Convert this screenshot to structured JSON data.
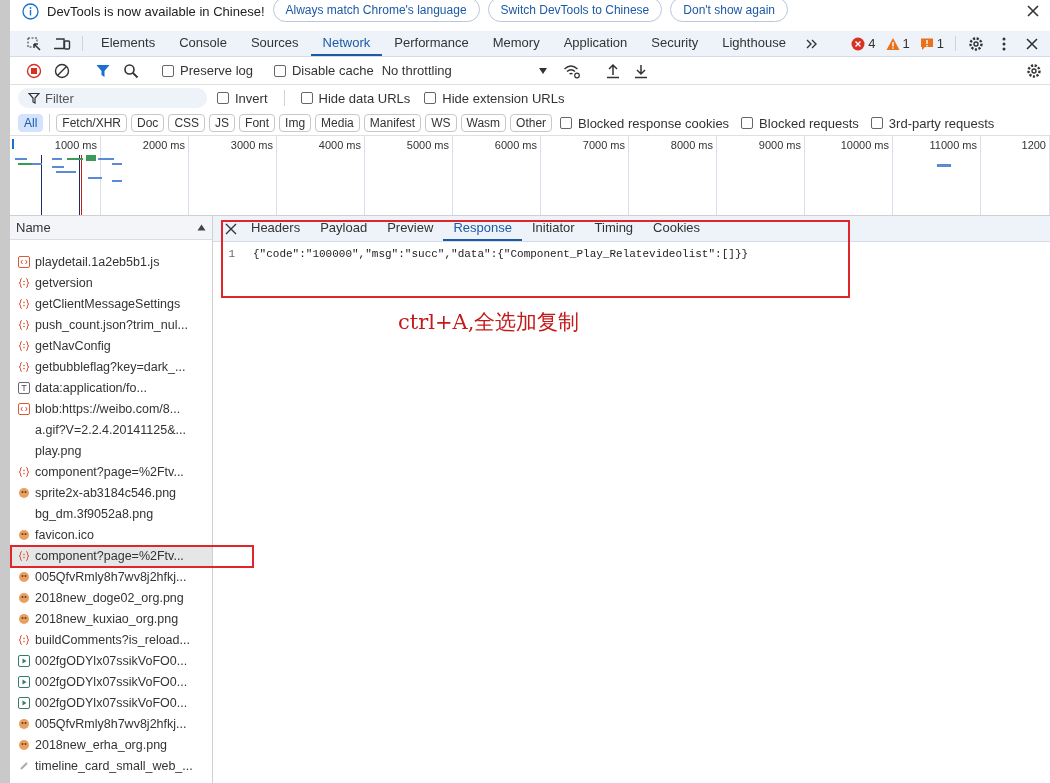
{
  "infobar": {
    "message": "DevTools is now available in Chinese!",
    "buttons": [
      "Always match Chrome's language",
      "Switch DevTools to Chinese",
      "Don't show again"
    ]
  },
  "panel_tabs": [
    {
      "label": "Elements",
      "selected": false
    },
    {
      "label": "Console",
      "selected": false
    },
    {
      "label": "Sources",
      "selected": false
    },
    {
      "label": "Network",
      "selected": true
    },
    {
      "label": "Performance",
      "selected": false
    },
    {
      "label": "Memory",
      "selected": false
    },
    {
      "label": "Application",
      "selected": false
    },
    {
      "label": "Security",
      "selected": false
    },
    {
      "label": "Lighthouse",
      "selected": false
    }
  ],
  "counters": {
    "errors": "4",
    "warnings": "1",
    "issues": "1"
  },
  "toolbar": {
    "preserve_log": {
      "label": "Preserve log",
      "checked": false
    },
    "disable_cache": {
      "label": "Disable cache",
      "checked": false
    },
    "throttling": "No throttling"
  },
  "filter_bar": {
    "placeholder": "Filter",
    "options": [
      {
        "label": "Invert",
        "checked": false
      },
      {
        "label": "Hide data URLs",
        "checked": false
      },
      {
        "label": "Hide extension URLs",
        "checked": false
      }
    ]
  },
  "type_filters": [
    {
      "label": "All",
      "selected": true
    },
    {
      "label": "Fetch/XHR",
      "selected": false
    },
    {
      "label": "Doc",
      "selected": false
    },
    {
      "label": "CSS",
      "selected": false
    },
    {
      "label": "JS",
      "selected": false
    },
    {
      "label": "Font",
      "selected": false
    },
    {
      "label": "Img",
      "selected": false
    },
    {
      "label": "Media",
      "selected": false
    },
    {
      "label": "Manifest",
      "selected": false
    },
    {
      "label": "WS",
      "selected": false
    },
    {
      "label": "Wasm",
      "selected": false
    },
    {
      "label": "Other",
      "selected": false
    }
  ],
  "more_filters": [
    {
      "label": "Blocked response cookies",
      "checked": false
    },
    {
      "label": "Blocked requests",
      "checked": false
    },
    {
      "label": "3rd-party requests",
      "checked": false
    }
  ],
  "timeline": {
    "ticks": [
      "1000 ms",
      "2000 ms",
      "3000 ms",
      "4000 ms",
      "5000 ms",
      "6000 ms",
      "7000 ms",
      "8000 ms",
      "9000 ms",
      "10000 ms",
      "11000 ms",
      "1200"
    ]
  },
  "requests": {
    "column": "Name",
    "rows": [
      {
        "name": "playdetail.1a2eb5b1.js",
        "kind": "script",
        "selected": false
      },
      {
        "name": "getversion",
        "kind": "fetch",
        "selected": false
      },
      {
        "name": "getClientMessageSettings",
        "kind": "fetch",
        "selected": false
      },
      {
        "name": "push_count.json?trim_nul...",
        "kind": "fetch",
        "selected": false
      },
      {
        "name": "getNavConfig",
        "kind": "fetch",
        "selected": false
      },
      {
        "name": "getbubbleflag?key=dark_...",
        "kind": "fetch",
        "selected": false
      },
      {
        "name": "data:application/fo...",
        "kind": "text",
        "selected": false
      },
      {
        "name": "blob:https://weibo.com/8...",
        "kind": "script",
        "selected": false
      },
      {
        "name": "a.gif?V=2.2.4.20141125&...",
        "kind": "blank",
        "selected": false
      },
      {
        "name": "play.png",
        "kind": "blank",
        "selected": false
      },
      {
        "name": "component?page=%2Ftv...",
        "kind": "fetch",
        "selected": false
      },
      {
        "name": "sprite2x-ab3184c546.png",
        "kind": "image",
        "selected": false
      },
      {
        "name": "bg_dm.3f9052a8.png",
        "kind": "blank",
        "selected": false
      },
      {
        "name": "favicon.ico",
        "kind": "image",
        "selected": false
      },
      {
        "name": "component?page=%2Ftv...",
        "kind": "fetch",
        "selected": true
      },
      {
        "name": "005QfvRmly8h7wv8j2hfkj...",
        "kind": "image",
        "selected": false
      },
      {
        "name": "2018new_doge02_org.png",
        "kind": "image",
        "selected": false
      },
      {
        "name": "2018new_kuxiao_org.png",
        "kind": "image",
        "selected": false
      },
      {
        "name": "buildComments?is_reload...",
        "kind": "fetch",
        "selected": false
      },
      {
        "name": "002fgODYlx07ssikVoFO0...",
        "kind": "media",
        "selected": false
      },
      {
        "name": "002fgODYlx07ssikVoFO0...",
        "kind": "media",
        "selected": false
      },
      {
        "name": "002fgODYlx07ssikVoFO0...",
        "kind": "media",
        "selected": false
      },
      {
        "name": "005QfvRmly8h7wv8j2hfkj...",
        "kind": "image",
        "selected": false
      },
      {
        "name": "2018new_erha_org.png",
        "kind": "image",
        "selected": false
      },
      {
        "name": "timeline_card_small_web_...",
        "kind": "link",
        "selected": false
      }
    ]
  },
  "details": {
    "tabs": [
      {
        "label": "Headers",
        "selected": false
      },
      {
        "label": "Payload",
        "selected": false
      },
      {
        "label": "Preview",
        "selected": false
      },
      {
        "label": "Response",
        "selected": true
      },
      {
        "label": "Initiator",
        "selected": false
      },
      {
        "label": "Timing",
        "selected": false
      },
      {
        "label": "Cookies",
        "selected": false
      }
    ],
    "lines": [
      {
        "number": "1",
        "text": "{\"code\":\"100000\",\"msg\":\"succ\",\"data\":{\"Component_Play_Relatevideolist\":[]}}"
      }
    ]
  },
  "annotation": "ctrl+A,全选加复制"
}
